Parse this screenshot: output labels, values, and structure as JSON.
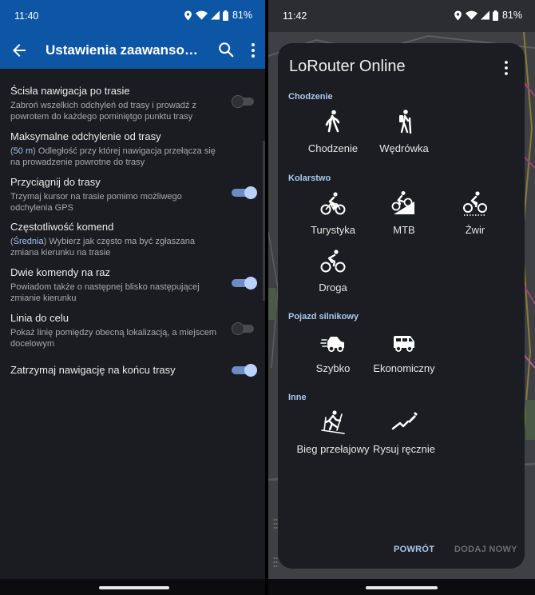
{
  "left": {
    "status": {
      "time": "11:40",
      "battery": "81%"
    },
    "title": "Ustawienia zaawansowane",
    "settings": [
      {
        "title": "Ścisła nawigacja po trasie",
        "subtitle": "Zabroń wszelkich odchyleń od trasy i prowadź z powrotem do każdego pominiętgo punktu trasy",
        "toggle": "off"
      },
      {
        "title": "Maksymalne odchylenie od trasy",
        "value": "50 m",
        "subtitle": "Odległość przy której nawigacja przełącza się na prowadzenie powrotne do trasy",
        "toggle": "none"
      },
      {
        "title": "Przyciągnij do trasy",
        "subtitle": "Trzymaj kursor na trasie pomimo możliwego odchylenia GPS",
        "toggle": "on"
      },
      {
        "title": "Częstotliwość komend",
        "value": "Średnia",
        "subtitle": "Wybierz jak często ma być zgłaszana zmiana kierunku na trasie",
        "toggle": "none"
      },
      {
        "title": "Dwie komendy na raz",
        "subtitle": "Powiadom także o następnej blisko następującej zmianie kierunku",
        "toggle": "on"
      },
      {
        "title": "Linia do celu",
        "subtitle": "Pokaż linię pomiędzy obecną lokalizacją, a miejscem docelowym",
        "toggle": "off"
      },
      {
        "title": "Zatrzymaj nawigację na końcu trasy",
        "subtitle": "",
        "toggle": "on"
      }
    ]
  },
  "right": {
    "status": {
      "time": "11:42",
      "battery": "81%"
    },
    "dialog": {
      "title": "LoRouter Online",
      "sections": [
        {
          "label": "Chodzenie",
          "options": [
            {
              "label": "Chodzenie",
              "icon": "walking-icon"
            },
            {
              "label": "Wędrówka",
              "icon": "hiking-icon"
            }
          ]
        },
        {
          "label": "Kolarstwo",
          "options": [
            {
              "label": "Turystyka",
              "icon": "bicycle-touring-icon"
            },
            {
              "label": "MTB",
              "icon": "mountain-bike-icon"
            },
            {
              "label": "Żwir",
              "icon": "gravel-bike-icon"
            },
            {
              "label": "Droga",
              "icon": "road-bike-icon"
            }
          ]
        },
        {
          "label": "Pojazd silnikowy",
          "options": [
            {
              "label": "Szybko",
              "icon": "fast-car-icon"
            },
            {
              "label": "Ekonomiczny",
              "icon": "economic-van-icon"
            }
          ]
        },
        {
          "label": "Inne",
          "options": [
            {
              "label": "Bieg przełajowy",
              "icon": "cross-country-ski-icon"
            },
            {
              "label": "Rysuj ręcznie",
              "icon": "draw-manually-icon"
            }
          ]
        }
      ],
      "buttons": {
        "back": "POWRÓT",
        "add": "DODAJ NOWY"
      }
    }
  }
}
